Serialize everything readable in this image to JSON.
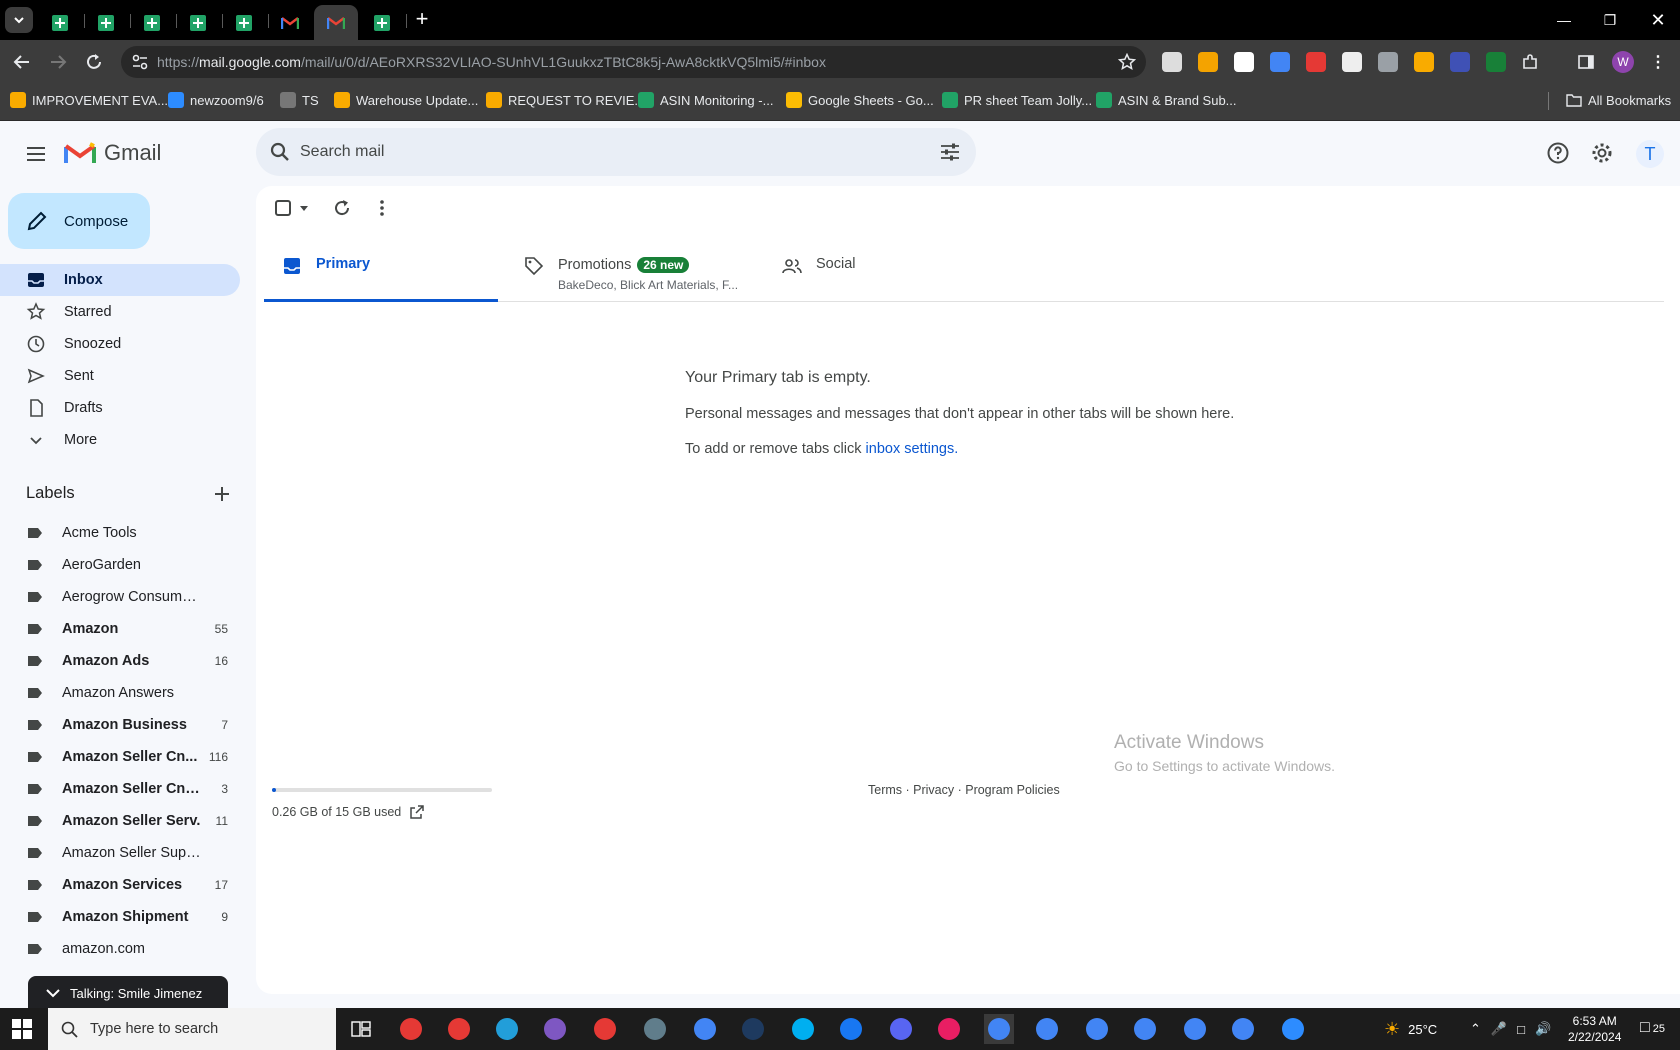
{
  "browser": {
    "url_prefix": "https://",
    "url_domain": "mail.google.com",
    "url_path": "/mail/u/0/d/AEoRXRS32VLIAO-SUnhVL1GuukxzTBtC8k5j-AwA8cktkVQ5lmi5/#inbox",
    "profile_initial": "W",
    "bookmarks": [
      {
        "label": "IMPROVEMENT EVA...",
        "color": "#f9ab00"
      },
      {
        "label": "newzoom9/6",
        "color": "#2d8cff"
      },
      {
        "label": "TS",
        "color": "#777777"
      },
      {
        "label": "Warehouse Update...",
        "color": "#f9ab00"
      },
      {
        "label": "REQUEST TO REVIE...",
        "color": "#f9ab00"
      },
      {
        "label": "ASIN Monitoring -...",
        "color": "#21a366"
      },
      {
        "label": "Google Sheets - Go...",
        "color": "#fbbc04"
      },
      {
        "label": "PR sheet Team Jolly...",
        "color": "#21a366"
      },
      {
        "label": "ASIN & Brand Sub...",
        "color": "#21a366"
      }
    ],
    "all_bookmarks": "All Bookmarks",
    "extension_colors": [
      "#dddddd",
      "#f4a300",
      "#ffffff",
      "#4285f4",
      "#e53935",
      "#eeeeee",
      "#9aa0a6",
      "#f9ab00",
      "#3f51b5",
      "#188038",
      "#9aa0a6"
    ]
  },
  "gmail": {
    "brand": "Gmail",
    "search_placeholder": "Search mail",
    "compose": "Compose",
    "avatar_initial": "T",
    "nav": [
      {
        "label": "Inbox",
        "icon": "inbox-icon"
      },
      {
        "label": "Starred",
        "icon": "star-icon"
      },
      {
        "label": "Snoozed",
        "icon": "clock-icon"
      },
      {
        "label": "Sent",
        "icon": "send-icon"
      },
      {
        "label": "Drafts",
        "icon": "draft-icon"
      },
      {
        "label": "More",
        "icon": "chevron-down-icon"
      }
    ],
    "labels_title": "Labels",
    "labels": [
      {
        "name": "Acme Tools",
        "count": "",
        "bold": false
      },
      {
        "name": "AeroGarden",
        "count": "",
        "bold": false
      },
      {
        "name": "Aerogrow Consumer Se...",
        "count": "",
        "bold": false
      },
      {
        "name": "Amazon",
        "count": "55",
        "bold": true
      },
      {
        "name": "Amazon Ads",
        "count": "16",
        "bold": true
      },
      {
        "name": "Amazon Answers",
        "count": "",
        "bold": false
      },
      {
        "name": "Amazon Business",
        "count": "7",
        "bold": true
      },
      {
        "name": "Amazon Seller Cn...",
        "count": "116",
        "bold": true
      },
      {
        "name": "Amazon Seller Cntr...",
        "count": "3",
        "bold": true
      },
      {
        "name": "Amazon Seller Serv.",
        "count": "11",
        "bold": true
      },
      {
        "name": "Amazon Seller Support",
        "count": "",
        "bold": false
      },
      {
        "name": "Amazon Services",
        "count": "17",
        "bold": true
      },
      {
        "name": "Amazon Shipment",
        "count": "9",
        "bold": true
      },
      {
        "name": "amazon.com",
        "count": "",
        "bold": false
      }
    ],
    "chat_bar": "Talking: Smile Jimenez",
    "tabs": {
      "primary": "Primary",
      "promotions": "Promotions",
      "promotions_badge": "26 new",
      "promotions_sub": "BakeDeco, Blick Art Materials, F...",
      "social": "Social"
    },
    "empty": {
      "title": "Your Primary tab is empty.",
      "desc": "Personal messages and messages that don't appear in other tabs will be shown here.",
      "hint_prefix": "To add or remove tabs click ",
      "hint_link": "inbox settings."
    },
    "storage_text": "0.26 GB of 15 GB used",
    "storage_fraction": 0.017,
    "footer": {
      "terms": "Terms",
      "privacy": "Privacy",
      "policies": "Program Policies",
      "sep": " · "
    }
  },
  "watermark": {
    "line1": "Activate Windows",
    "line2": "Go to Settings to activate Windows."
  },
  "taskbar": {
    "search_placeholder": "Type here to search",
    "app_colors": [
      "#e53935",
      "#e53935",
      "#229ed9",
      "#7e57c2",
      "#e53935",
      "#607d8b",
      "#4285f4",
      "#1e3a5f",
      "#00aff0",
      "#1877f2",
      "#5865f2",
      "#e91e63",
      "#4285f4",
      "#4285f4",
      "#4285f4",
      "#4285f4",
      "#4285f4",
      "#4285f4",
      "#2d8cff"
    ],
    "weather": "25°C",
    "time": "6:53 AM",
    "date": "2/22/2024",
    "notification_count": "25"
  }
}
